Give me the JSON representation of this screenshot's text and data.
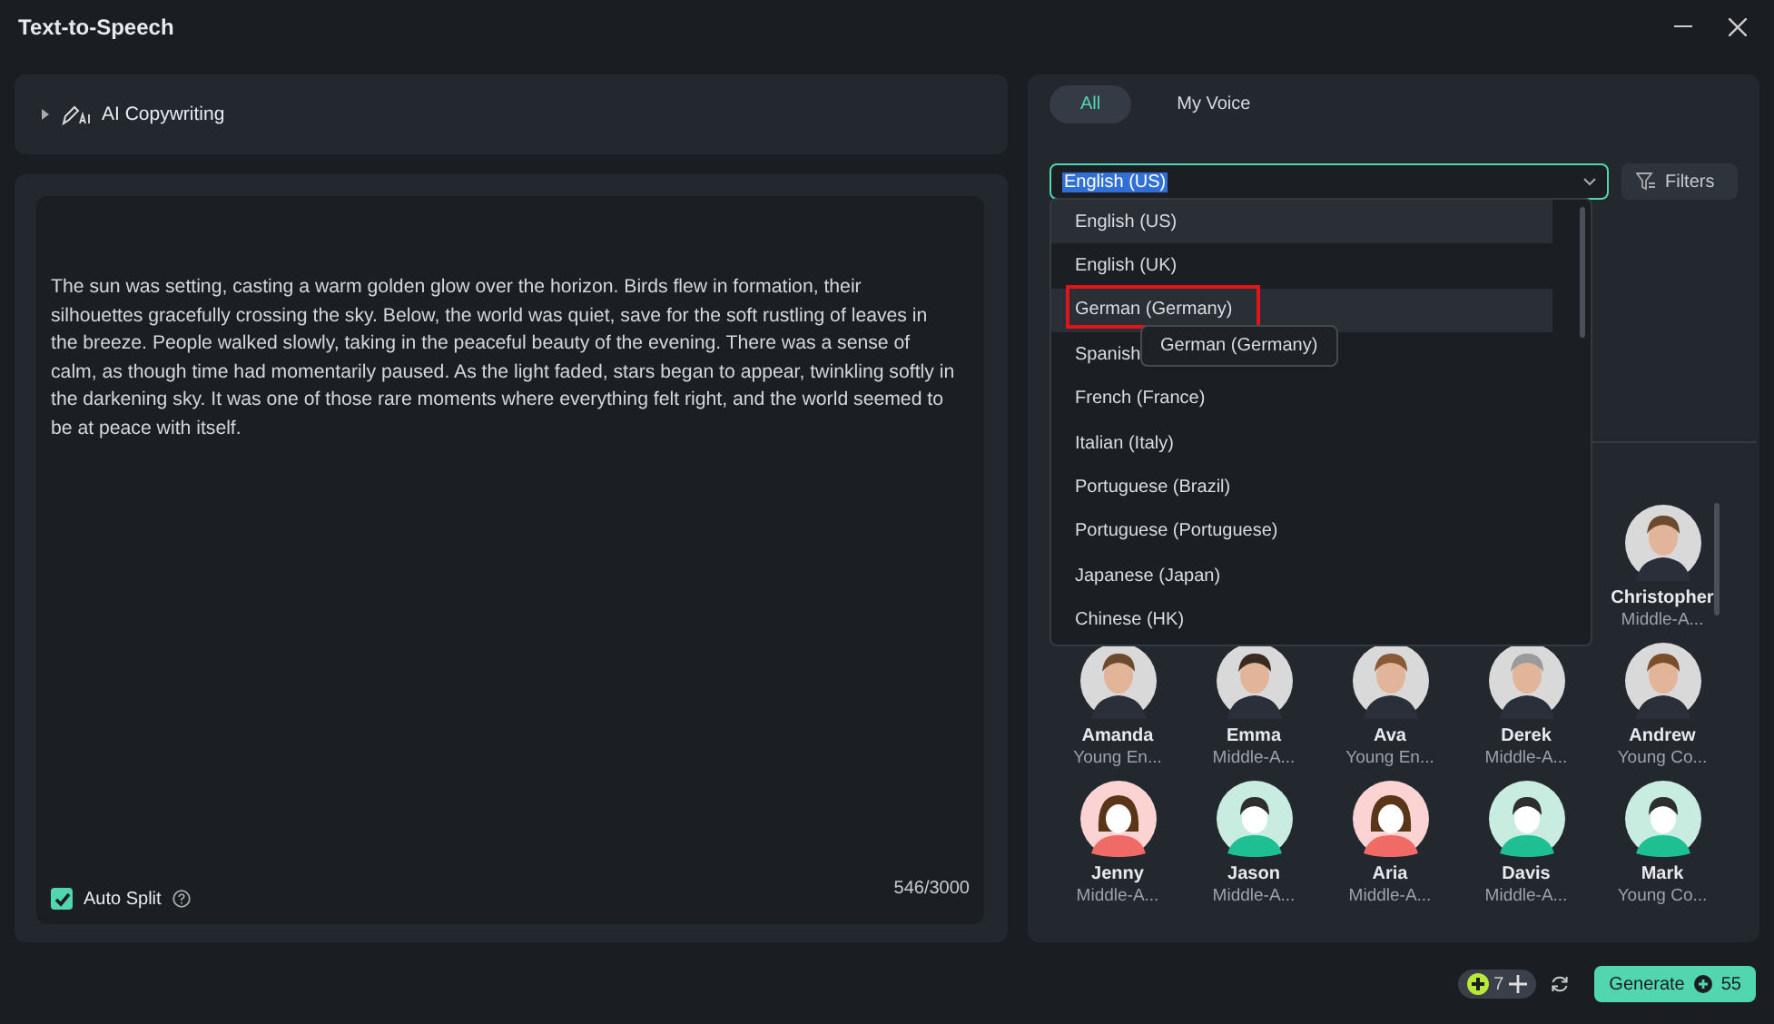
{
  "window": {
    "title": "Text-to-Speech"
  },
  "ai_copywriting": {
    "label": "AI Copywriting",
    "expanded": false
  },
  "editor": {
    "text": "The sun was setting, casting a warm golden glow over the horizon. Birds flew in formation, their silhouettes gracefully crossing the sky. Below, the world was quiet, save for the soft rustling of leaves in the breeze. People walked slowly, taking in the peaceful beauty of the evening. There was a sense of calm, as though time had momentarily paused. As the light faded, stars began to appear, twinkling softly in the darkening sky. It was one of those rare moments where everything felt right, and the world seemed to be at peace with itself.",
    "auto_split": {
      "label": "Auto Split",
      "checked": true
    },
    "count": "546/3000"
  },
  "tabs": [
    {
      "label": "All",
      "selected": true
    },
    {
      "label": "My Voice",
      "selected": false
    }
  ],
  "language": {
    "value": "English (US)",
    "filters": "Filters",
    "options": [
      {
        "label": "English (US)",
        "selected": true,
        "hovered": false,
        "marked": false
      },
      {
        "label": "English (UK)",
        "selected": false,
        "hovered": false,
        "marked": false
      },
      {
        "label": "German (Germany)",
        "selected": false,
        "hovered": true,
        "marked": true
      },
      {
        "label": "Spanish",
        "selected": false,
        "hovered": false,
        "marked": false
      },
      {
        "label": "French (France)",
        "selected": false,
        "hovered": false,
        "marked": false
      },
      {
        "label": "Italian (Italy)",
        "selected": false,
        "hovered": false,
        "marked": false
      },
      {
        "label": "Portuguese (Brazil)",
        "selected": false,
        "hovered": false,
        "marked": false
      },
      {
        "label": "Portuguese (Portuguese)",
        "selected": false,
        "hovered": false,
        "marked": false
      },
      {
        "label": "Japanese (Japan)",
        "selected": false,
        "hovered": false,
        "marked": false
      },
      {
        "label": "Chinese (HK)",
        "selected": false,
        "hovered": false,
        "marked": false
      }
    ],
    "tooltip": "German (Germany)"
  },
  "voice_rows": [
    [
      {
        "name": "Christopher",
        "desc": "Middle-A...",
        "kind": "photo"
      }
    ],
    [
      {
        "name": "Amanda",
        "desc": "Young En...",
        "kind": "photo"
      },
      {
        "name": "Emma",
        "desc": "Middle-A...",
        "kind": "photo"
      },
      {
        "name": "Ava",
        "desc": "Young En...",
        "kind": "photo"
      },
      {
        "name": "Derek",
        "desc": "Middle-A...",
        "kind": "photo"
      },
      {
        "name": "Andrew",
        "desc": "Young Co...",
        "kind": "photo"
      }
    ],
    [
      {
        "name": "Jenny",
        "desc": "Middle-A...",
        "kind": "female"
      },
      {
        "name": "Jason",
        "desc": "Middle-A...",
        "kind": "male"
      },
      {
        "name": "Aria",
        "desc": "Middle-A...",
        "kind": "female"
      },
      {
        "name": "Davis",
        "desc": "Middle-A...",
        "kind": "male"
      },
      {
        "name": "Mark",
        "desc": "Young Co...",
        "kind": "male"
      }
    ]
  ],
  "footer": {
    "credits": "7",
    "generate": "Generate",
    "cost": "55"
  }
}
